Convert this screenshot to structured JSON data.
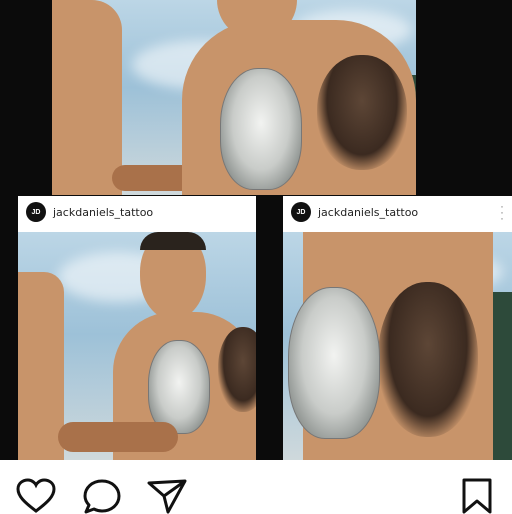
{
  "posts": [
    {
      "username": "jackdaniels_tattoo",
      "avatar_text": "JD"
    },
    {
      "username": "jackdaniels_tattoo",
      "avatar_text": "JD"
    }
  ],
  "actions": {
    "icons": [
      "heart-icon",
      "comment-icon",
      "share-icon",
      "bookmark-icon"
    ]
  },
  "colors": {
    "background": "#0b0b0b",
    "card": "#ffffff",
    "sky": "#9dc1d8",
    "skin": "#c8946a"
  }
}
